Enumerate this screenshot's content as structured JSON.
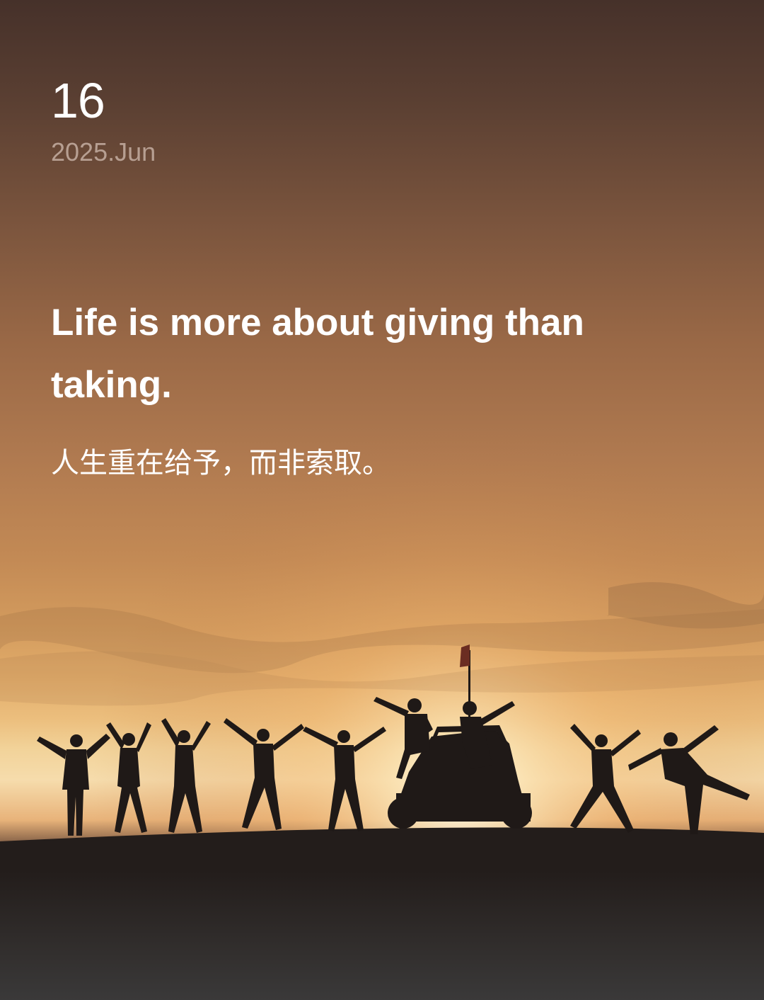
{
  "date": {
    "day": "16",
    "year_month": "2025.Jun"
  },
  "quote": {
    "english": "Life is more about giving than taking.",
    "chinese": "人生重在给予，而非索取。"
  },
  "colors": {
    "sky_top": "#46312a",
    "sky_glow": "#f6dcac",
    "ground": "#231d1b",
    "text_primary": "#ffffff",
    "text_secondary": "#b79f92"
  }
}
